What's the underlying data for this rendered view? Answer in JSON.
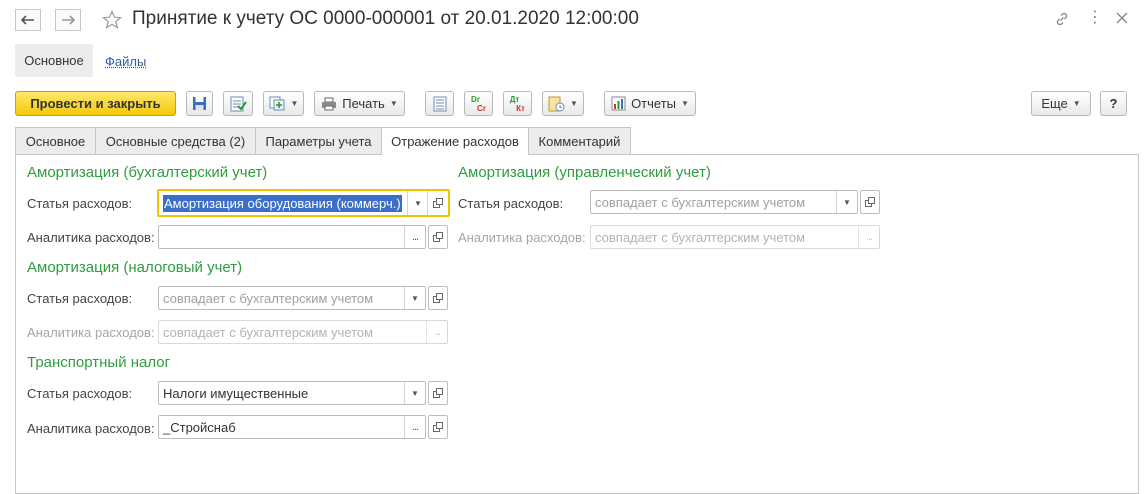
{
  "window": {
    "title": "Принятие к учету ОС 0000-000001 от 20.01.2020 12:00:00"
  },
  "top_tabs": {
    "main": "Основное",
    "files": "Файлы"
  },
  "toolbar": {
    "post_close": "Провести и закрыть",
    "print": "Печать",
    "reports": "Отчеты",
    "more": "Еще",
    "help": "?",
    "icons": [
      "save-icon",
      "post-icon",
      "create-based-icon",
      "print-icon",
      "journal-icon",
      "dr-cr-icon",
      "dt-kt-icon",
      "attach-icon",
      "reports-icon"
    ],
    "dr_text": "Dr",
    "cr_text": "Cr",
    "dt_text": "Дт",
    "kt_text": "Кт"
  },
  "tabs": [
    "Основное",
    "Основные средства (2)",
    "Параметры учета",
    "Отражение расходов",
    "Комментарий"
  ],
  "active_tab": "Отражение расходов",
  "form": {
    "accounting": {
      "title": "Амортизация (бухгалтерский учет)",
      "expense_label": "Статья расходов:",
      "expense_value": "Амортизация оборудования (коммерч.)",
      "analytics_label": "Аналитика расходов:",
      "analytics_value": ""
    },
    "tax": {
      "title": "Амортизация (налоговый учет)",
      "expense_label": "Статья расходов:",
      "expense_placeholder": "совпадает с бухгалтерским учетом",
      "analytics_label": "Аналитика расходов:",
      "analytics_placeholder": "совпадает с бухгалтерским учетом"
    },
    "transport": {
      "title": "Транспортный налог",
      "expense_label": "Статья расходов:",
      "expense_value": "Налоги имущественные",
      "analytics_label": "Аналитика расходов:",
      "analytics_value": "_Стройснаб"
    },
    "management": {
      "title": "Амортизация (управленческий учет)",
      "expense_label": "Статья расходов:",
      "expense_placeholder": "совпадает с бухгалтерским учетом",
      "analytics_label": "Аналитика расходов:",
      "analytics_placeholder": "совпадает с бухгалтерским учетом"
    }
  },
  "colors": {
    "section_title": "#2f9d40",
    "primary_button": "#f5c80c",
    "focus_border": "#f2c300",
    "selection": "#3b6ec9",
    "link": "#2a5fa8"
  }
}
